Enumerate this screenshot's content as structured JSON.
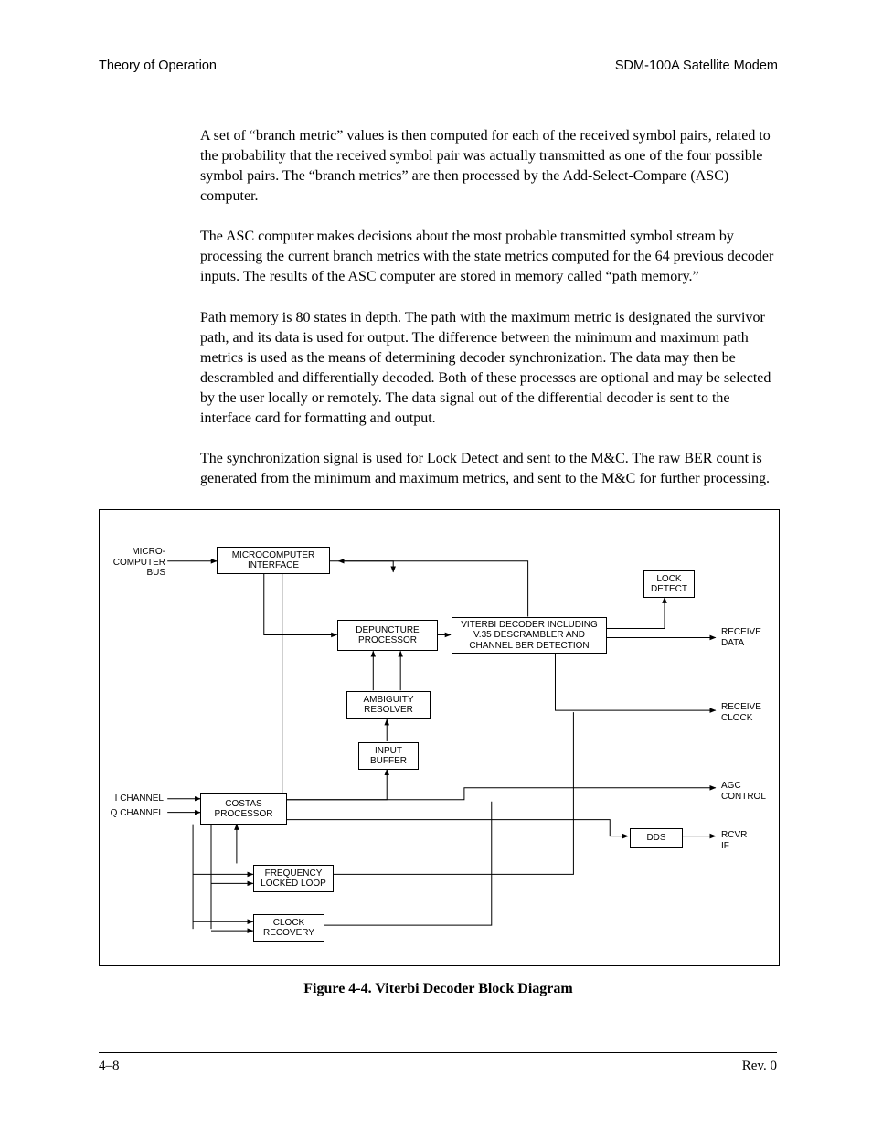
{
  "header": {
    "left": "Theory of Operation",
    "right": "SDM-100A Satellite Modem"
  },
  "paragraphs": {
    "p1": "A set of “branch metric” values is then computed for each of the received symbol pairs, related to the probability that the received symbol pair was actually transmitted as one of the four possible symbol pairs. The “branch metrics” are then processed by the Add-Select-Compare (ASC) computer.",
    "p2": "The ASC computer makes decisions about the most probable transmitted symbol stream by processing the current branch metrics with the state metrics computed for the 64 previous decoder inputs. The results of the ASC computer are stored in memory called “path memory.”",
    "p3": "Path memory is 80 states in depth. The path with the maximum metric is designated the survivor path, and its data is used for output. The difference between the minimum and maximum path metrics is used as the means of determining decoder synchronization. The data may then be descrambled and differentially decoded. Both of these processes are optional and may be selected by the user locally or remotely. The data signal out of the differential decoder is sent to the interface card for formatting and output.",
    "p4": "The synchronization signal is used for Lock Detect and sent to the M&C. The raw BER count is generated from the minimum and maximum metrics, and sent to the M&C for further processing."
  },
  "diagram": {
    "caption": "Figure 4-4.  Viterbi Decoder Block Diagram",
    "boxes": {
      "mcu_if": {
        "l1": "MICROCOMPUTER",
        "l2": "INTERFACE"
      },
      "depuncture": {
        "l1": "DEPUNCTURE",
        "l2": "PROCESSOR"
      },
      "viterbi": {
        "l1": "VITERBI DECODER INCLUDING",
        "l2": "V.35 DESCRAMBLER AND",
        "l3": "CHANNEL BER DETECTION"
      },
      "lock": {
        "l1": "LOCK",
        "l2": "DETECT"
      },
      "ambiguity": {
        "l1": "AMBIGUITY",
        "l2": "RESOLVER"
      },
      "ibuf": {
        "l1": "INPUT",
        "l2": "BUFFER"
      },
      "costas": {
        "l1": "COSTAS",
        "l2": "PROCESSOR"
      },
      "dds": {
        "l1": "DDS"
      },
      "fll": {
        "l1": "FREQUENCY",
        "l2": "LOCKED LOOP"
      },
      "clkrec": {
        "l1": "CLOCK",
        "l2": "RECOVERY"
      }
    },
    "labels": {
      "mcu_bus1": "MICRO-",
      "mcu_bus2": "COMPUTER",
      "mcu_bus3": "BUS",
      "ich": "I CHANNEL",
      "qch": "Q CHANNEL",
      "rxdata1": "RECEIVE",
      "rxdata2": "DATA",
      "rxclk1": "RECEIVE",
      "rxclk2": "CLOCK",
      "agc1": "AGC",
      "agc2": "CONTROL",
      "rcvr1": "RCVR",
      "rcvr2": "IF"
    }
  },
  "footer": {
    "left": "4–8",
    "right": "Rev. 0"
  }
}
